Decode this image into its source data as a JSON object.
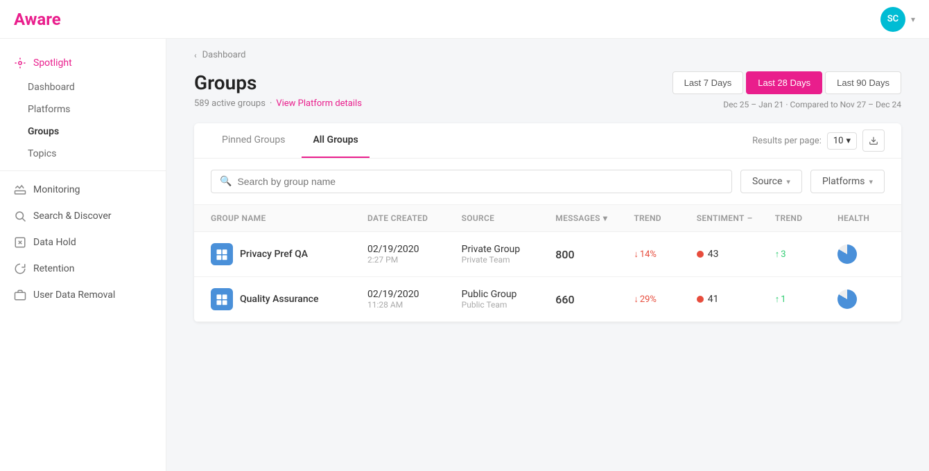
{
  "app": {
    "logo": "Aware",
    "user_initials": "SC"
  },
  "sidebar": {
    "spotlight_label": "Spotlight",
    "items": [
      {
        "id": "dashboard",
        "label": "Dashboard"
      },
      {
        "id": "platforms",
        "label": "Platforms"
      },
      {
        "id": "groups",
        "label": "Groups",
        "active": true
      },
      {
        "id": "topics",
        "label": "Topics"
      }
    ],
    "nav_items": [
      {
        "id": "monitoring",
        "label": "Monitoring"
      },
      {
        "id": "search-discover",
        "label": "Search & Discover"
      },
      {
        "id": "data-hold",
        "label": "Data Hold"
      },
      {
        "id": "retention",
        "label": "Retention"
      },
      {
        "id": "user-data-removal",
        "label": "User Data Removal"
      }
    ]
  },
  "breadcrumb": {
    "label": "Dashboard"
  },
  "page": {
    "title": "Groups",
    "subtitle": "589 active groups",
    "view_details_link": "View Platform details",
    "separator": "·"
  },
  "date_range": {
    "buttons": [
      {
        "id": "7days",
        "label": "Last 7 Days"
      },
      {
        "id": "28days",
        "label": "Last 28 Days",
        "active": true
      },
      {
        "id": "90days",
        "label": "Last 90 Days"
      }
    ],
    "current": "Dec 25 – Jan 21",
    "compared": "Compared to Nov 27 – Dec 24"
  },
  "tabs": {
    "items": [
      {
        "id": "pinned",
        "label": "Pinned Groups"
      },
      {
        "id": "all",
        "label": "All Groups",
        "active": true
      }
    ],
    "results_label": "Results per page:",
    "results_value": "10"
  },
  "search": {
    "placeholder": "Search by group name"
  },
  "filters": {
    "source_label": "Source",
    "platforms_label": "Platforms"
  },
  "table": {
    "headers": [
      {
        "id": "group-name",
        "label": "Group Name"
      },
      {
        "id": "date-created",
        "label": "Date Created"
      },
      {
        "id": "source",
        "label": "Source"
      },
      {
        "id": "messages",
        "label": "Messages"
      },
      {
        "id": "messages-trend",
        "label": "Trend"
      },
      {
        "id": "sentiment",
        "label": "Sentiment"
      },
      {
        "id": "sentiment-trend",
        "label": "Trend"
      },
      {
        "id": "health",
        "label": "Health"
      }
    ],
    "rows": [
      {
        "id": "row1",
        "group_name": "Privacy Pref QA",
        "date_created": "02/19/2020",
        "time_created": "2:27 PM",
        "source_type": "Private Group",
        "source_sub": "Private Team",
        "messages": "800",
        "messages_trend": "14%",
        "messages_trend_dir": "down",
        "sentiment_score": "43",
        "sentiment_trend": "3",
        "sentiment_trend_dir": "up"
      },
      {
        "id": "row2",
        "group_name": "Quality Assurance",
        "date_created": "02/19/2020",
        "time_created": "11:28 AM",
        "source_type": "Public Group",
        "source_sub": "Public Team",
        "messages": "660",
        "messages_trend": "29%",
        "messages_trend_dir": "down",
        "sentiment_score": "41",
        "sentiment_trend": "1",
        "sentiment_trend_dir": "up"
      }
    ]
  }
}
